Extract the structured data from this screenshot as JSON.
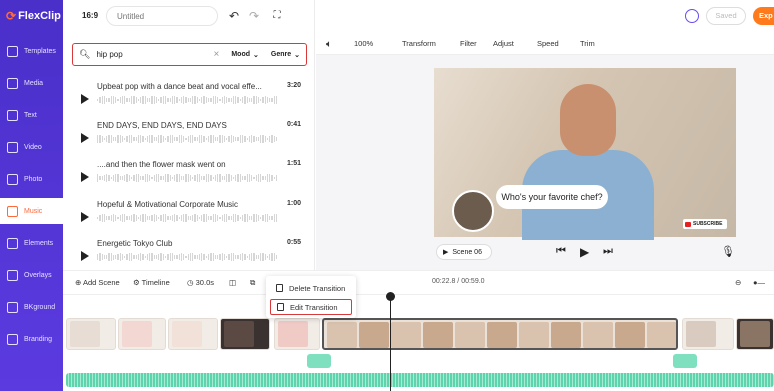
{
  "app": {
    "logo": "FlexClip",
    "ratio": "16:9",
    "title_placeholder": "Untitled",
    "saved": "Saved",
    "export": "Exp"
  },
  "sidebar": {
    "items": [
      {
        "label": "Templates",
        "icon": "templates-icon"
      },
      {
        "label": "Media",
        "icon": "media-icon"
      },
      {
        "label": "Text",
        "icon": "text-icon"
      },
      {
        "label": "Video",
        "icon": "video-icon"
      },
      {
        "label": "Photo",
        "icon": "photo-icon"
      },
      {
        "label": "Music",
        "icon": "music-icon",
        "active": true
      },
      {
        "label": "Elements",
        "icon": "elements-icon"
      },
      {
        "label": "Overlays",
        "icon": "overlays-icon"
      },
      {
        "label": "BKground",
        "icon": "background-icon"
      },
      {
        "label": "Branding",
        "icon": "branding-icon"
      }
    ]
  },
  "music": {
    "search": {
      "query": "hip pop",
      "mood": "Mood",
      "genre": "Genre"
    },
    "tracks": [
      {
        "name": "Upbeat pop with a dance beat and vocal effe...",
        "duration": "3:20"
      },
      {
        "name": "END DAYS, END DAYS, END DAYS",
        "duration": "0:41"
      },
      {
        "name": "....and then the flower mask went on",
        "duration": "1:51"
      },
      {
        "name": "Hopeful & Motivational Corporate Music",
        "duration": "1:00"
      },
      {
        "name": "Energetic Tokyo Club",
        "duration": "0:55"
      }
    ]
  },
  "toolbar": {
    "volume": "100%",
    "transform": "Transform",
    "filter": "Filter",
    "adjust": "Adjust",
    "speed": "Speed",
    "trim": "Trim"
  },
  "preview": {
    "speech": "Who's your favorite chef?",
    "subscribe": "SUBSCRIBE",
    "scene": "Scene 06"
  },
  "timeline": {
    "add_scene": "Add Scene",
    "timeline": "Timeline",
    "duration": "30.0s",
    "time": "00:22.8 / 00:59.0"
  },
  "context_menu": {
    "delete": "Delete Transition",
    "edit": "Edit Transition"
  },
  "colors": {
    "rail": "#5233d6",
    "accent": "#ff6a3d",
    "highlight": "#d83a3a",
    "audio": "#7fe0bf"
  }
}
